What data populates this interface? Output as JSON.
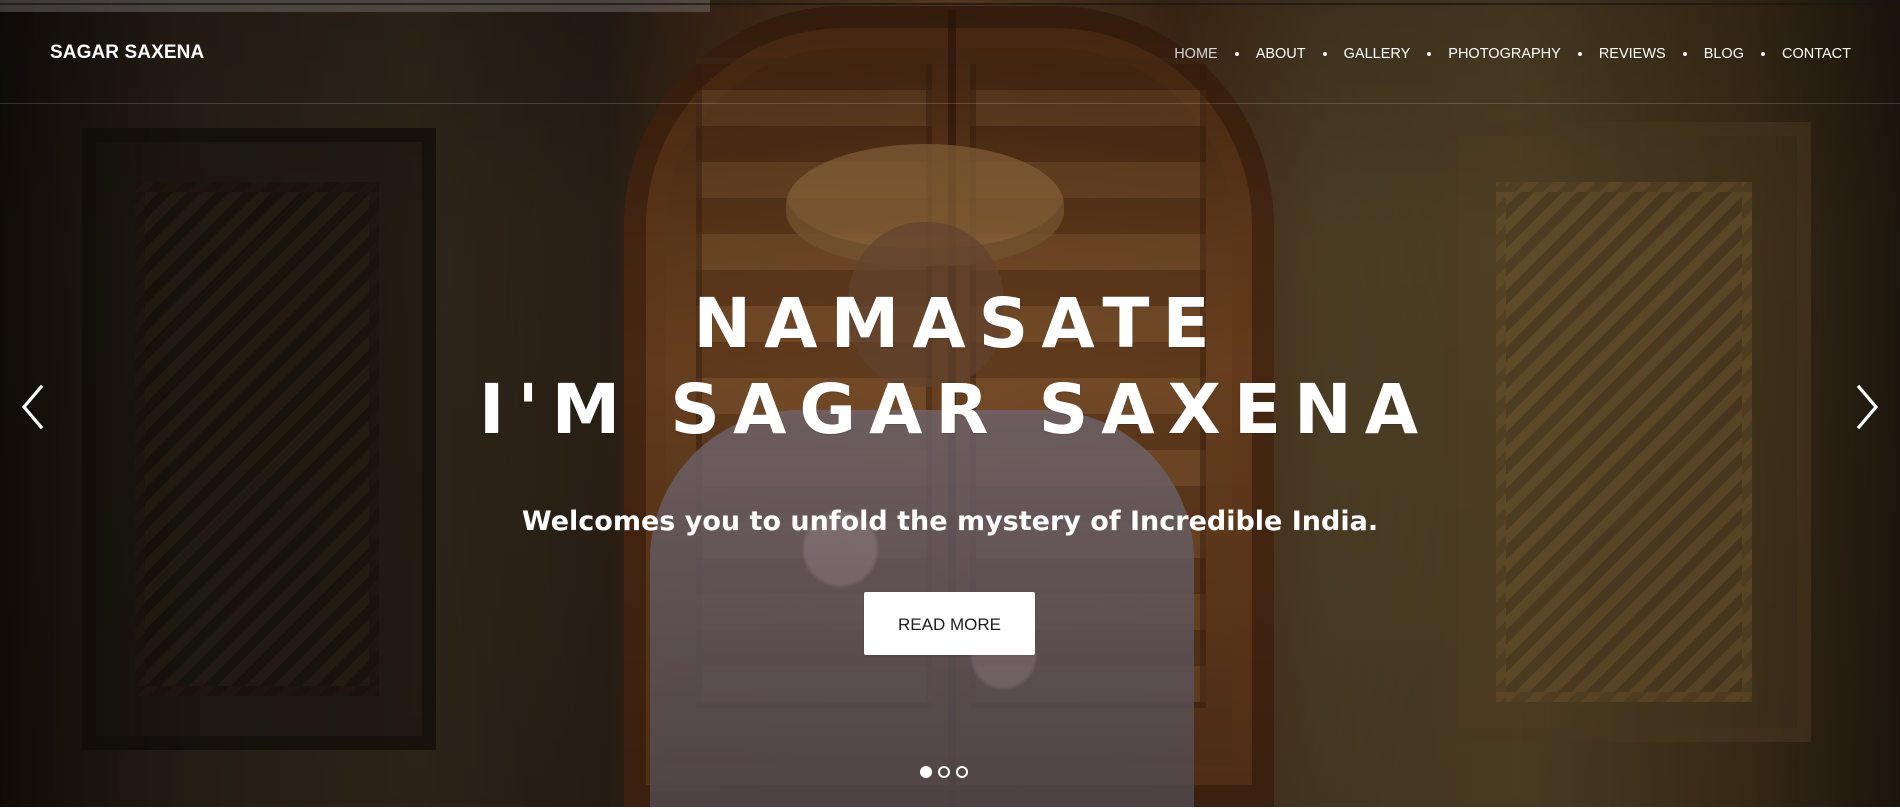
{
  "header": {
    "brand": "SAGAR SAXENA",
    "nav": [
      {
        "label": "HOME",
        "active": true
      },
      {
        "label": "ABOUT",
        "active": false
      },
      {
        "label": "GALLERY",
        "active": false
      },
      {
        "label": "PHOTOGRAPHY",
        "active": false
      },
      {
        "label": "REVIEWS",
        "active": false
      },
      {
        "label": "BLOG",
        "active": false
      },
      {
        "label": "CONTACT",
        "active": false
      }
    ]
  },
  "hero": {
    "headline_line1": "NAMASATE",
    "headline_line2": "I'M SAGAR SAXENA",
    "subtitle": "Welcomes you to unfold the mystery of Incredible India.",
    "button_label": "READ MORE",
    "slides": [
      {
        "active": true
      },
      {
        "active": false
      },
      {
        "active": false
      }
    ]
  },
  "icons": {
    "previous": "chevron-left-icon",
    "next": "chevron-right-icon"
  },
  "colors": {
    "text": "#ffffff",
    "button_background": "#ffffff",
    "button_text": "#1e1e1e",
    "active_nav": "#d6d6d6"
  }
}
